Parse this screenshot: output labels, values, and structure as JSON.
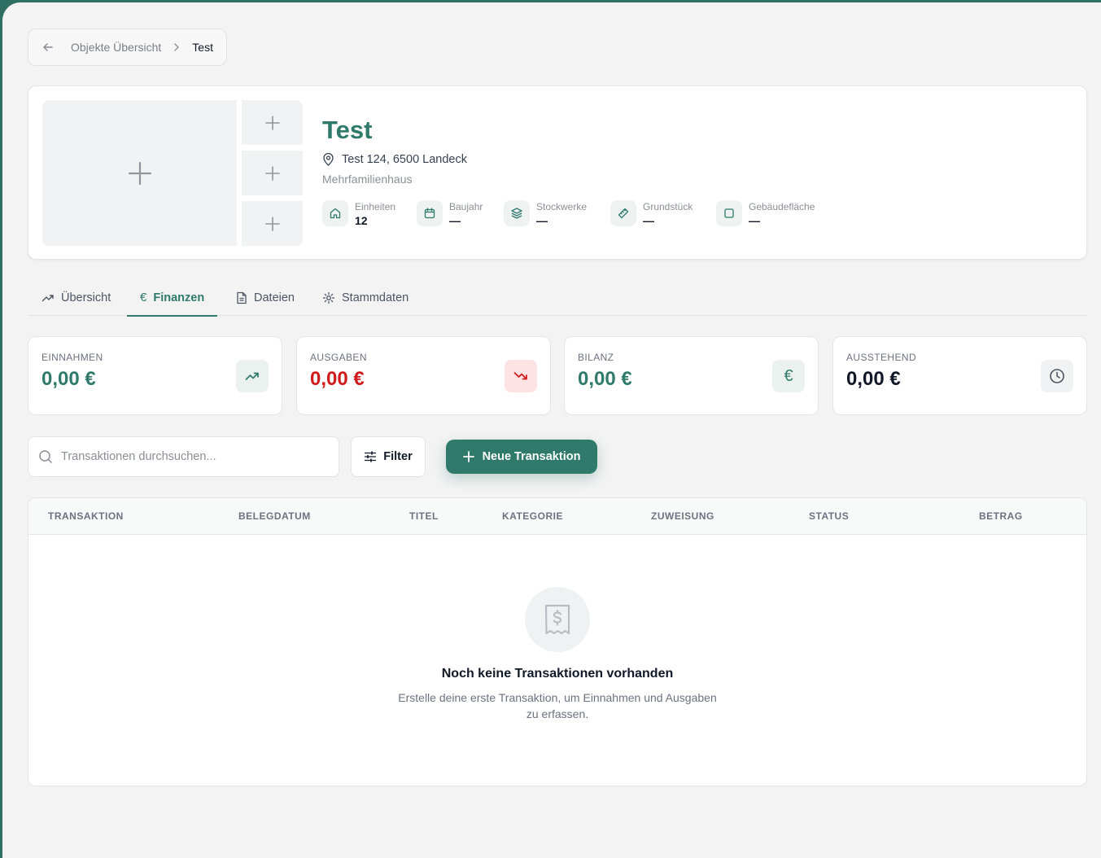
{
  "breadcrumb": {
    "parent": "Objekte Übersicht",
    "current": "Test"
  },
  "property": {
    "title": "Test",
    "address": "Test 124, 6500 Landeck",
    "type": "Mehrfamilienhaus",
    "stats": [
      {
        "label": "Einheiten",
        "value": "12",
        "icon": "home-icon"
      },
      {
        "label": "Baujahr",
        "value": "—",
        "icon": "calendar-icon"
      },
      {
        "label": "Stockwerke",
        "value": "—",
        "icon": "layers-icon"
      },
      {
        "label": "Grundstück",
        "value": "—",
        "icon": "ruler-icon"
      },
      {
        "label": "Gebäudefläche",
        "value": "—",
        "icon": "square-icon"
      }
    ]
  },
  "tabs": [
    {
      "label": "Übersicht",
      "icon": "trending-up-icon"
    },
    {
      "label": "Finanzen",
      "icon": "euro-icon"
    },
    {
      "label": "Dateien",
      "icon": "file-icon"
    },
    {
      "label": "Stammdaten",
      "icon": "gear-icon"
    }
  ],
  "kpis": [
    {
      "label": "EINNAHMEN",
      "value": "0,00 €",
      "icon": "trending-up-icon"
    },
    {
      "label": "AUSGABEN",
      "value": "0,00 €",
      "icon": "trending-down-icon"
    },
    {
      "label": "BILANZ",
      "value": "0,00 €",
      "icon": "euro-icon"
    },
    {
      "label": "AUSSTEHEND",
      "value": "0,00 €",
      "icon": "clock-icon"
    }
  ],
  "toolbar": {
    "search_placeholder": "Transaktionen durchsuchen...",
    "filter_label": "Filter",
    "new_label": "Neue Transaktion"
  },
  "table": {
    "columns": [
      "TRANSAKTION",
      "BELEGDATUM",
      "TITEL",
      "KATEGORIE",
      "ZUWEISUNG",
      "STATUS",
      "BETRAG"
    ],
    "empty_title": "Noch keine Transaktionen vorhanden",
    "empty_text": "Erstelle deine erste Transaktion, um Einnahmen und Ausgaben zu erfassen."
  },
  "colors": {
    "accent": "#2f7a6b",
    "income": "#2f7a6b",
    "expense": "#d11a1a",
    "background": "#f3f3f3"
  }
}
